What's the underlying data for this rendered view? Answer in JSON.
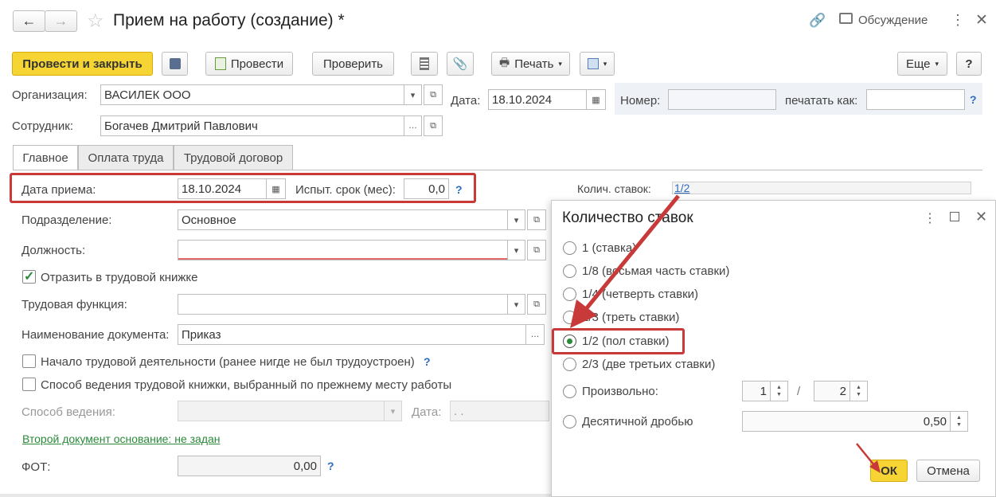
{
  "window": {
    "title": "Прием на работу (создание) *",
    "discuss_label": "Обсуждение"
  },
  "toolbar": {
    "post_close": "Провести и закрыть",
    "post": "Провести",
    "check": "Проверить",
    "print": "Печать",
    "more": "Еще",
    "help": "?"
  },
  "header": {
    "org_label": "Организация:",
    "org_value": "ВАСИЛЕК ООО",
    "date_label": "Дата:",
    "date_value": "18.10.2024",
    "number_label": "Номер:",
    "number_value": "",
    "print_as_label": "печатать как:",
    "print_as_value": "",
    "employee_label": "Сотрудник:",
    "employee_value": "Богачев Дмитрий Павлович"
  },
  "tabs": [
    "Главное",
    "Оплата труда",
    "Трудовой договор"
  ],
  "main": {
    "hire_date_label": "Дата приема:",
    "hire_date_value": "18.10.2024",
    "probation_label": "Испыт. срок (мес):",
    "probation_value": "0,0",
    "rates_label": "Колич. ставок:",
    "rates_value": "1/2",
    "division_label": "Подразделение:",
    "division_value": "Основное",
    "position_label": "Должность:",
    "position_value": "",
    "workbook_check": "Отразить в трудовой книжке",
    "labor_function_label": "Трудовая функция:",
    "labor_function_value": "",
    "doc_name_label": "Наименование документа:",
    "doc_name_value": "Приказ",
    "career_start_check": "Начало трудовой деятельности (ранее нигде не был трудоустроен)",
    "prev_method_check": "Способ ведения трудовой книжки, выбранный по прежнему месту работы",
    "method_label": "Способ ведения:",
    "method_value": "",
    "method_date_label": "Дата:",
    "method_date_value": ". .",
    "second_doc_link": "Второй документ основание: не задан",
    "fot_label": "ФОТ:",
    "fot_value": "0,00"
  },
  "dialog": {
    "title": "Количество ставок",
    "options": [
      "1 (ставка)",
      "1/8 (восьмая часть ставки)",
      "1/4 (четверть ставки)",
      "1/3 (треть ставки)",
      "1/2 (пол ставки)",
      "2/3 (две третьих ставки)"
    ],
    "selected_index": 4,
    "arbitrary_label": "Произвольно:",
    "numerator": "1",
    "slash": "/",
    "denominator": "2",
    "decimal_label": "Десятичной дробью",
    "decimal_value": "0,50",
    "ok": "ОК",
    "cancel": "Отмена"
  },
  "colors": {
    "accent_yellow": "#f5d433",
    "highlight_red": "#c83a3a",
    "link_green": "#2a8a3a",
    "link_blue": "#2d6cbf"
  }
}
